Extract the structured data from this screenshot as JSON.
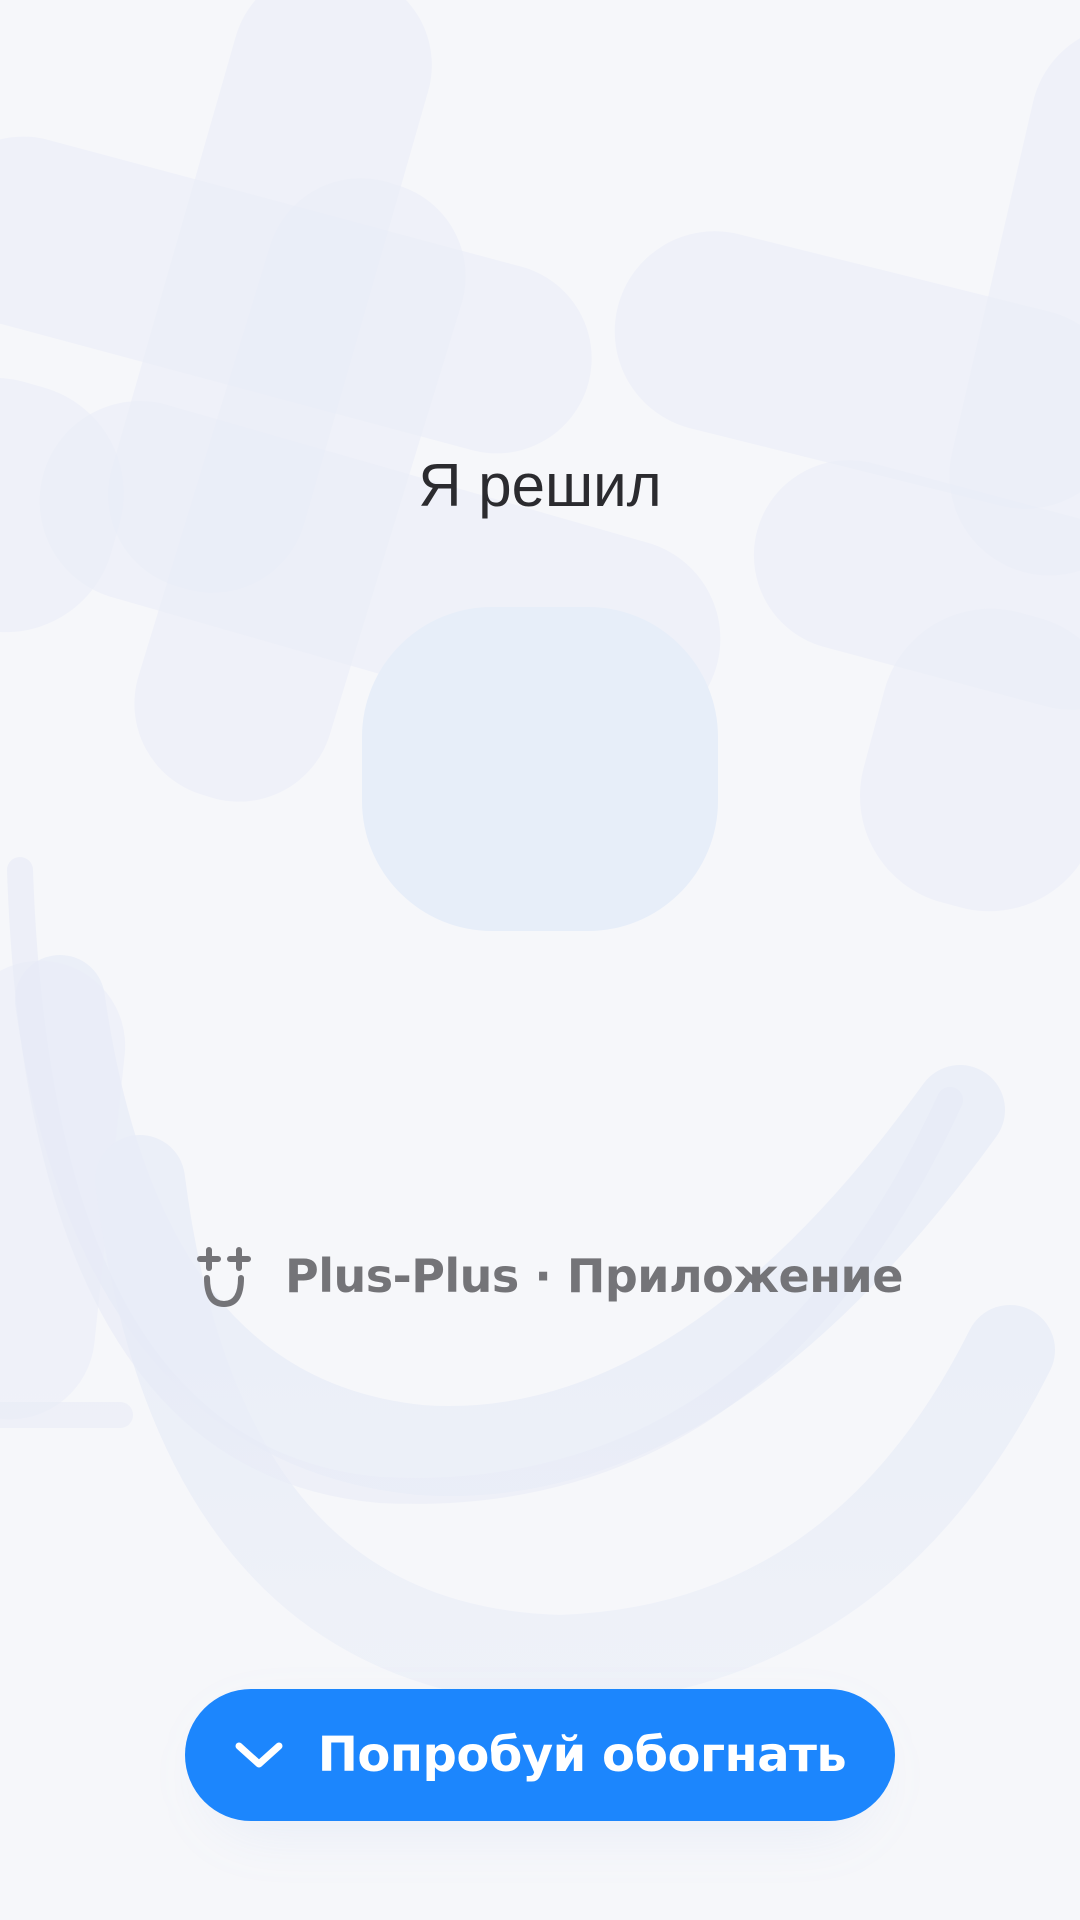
{
  "title": "Я решил",
  "app": {
    "name": "Plus-Plus · Приложение",
    "icon": "smiley-plus-icon"
  },
  "cta": {
    "label": "Попробуй обогнать",
    "icon": "chevron-down-icon"
  },
  "colors": {
    "background": "#F6F7FA",
    "accent": "#1C86FD",
    "avatar_placeholder": "#E7EEF9",
    "title_text": "#2B2B2F",
    "app_text": "#747478"
  }
}
